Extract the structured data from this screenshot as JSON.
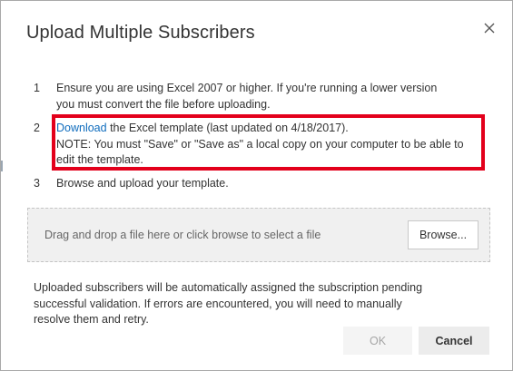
{
  "dialog": {
    "title": "Upload Multiple Subscribers",
    "close_icon": "close-icon"
  },
  "steps": [
    {
      "number": "1",
      "lines": [
        "Ensure you are using Excel 2007 or higher. If you're running a lower version",
        "you must convert the file before uploading."
      ]
    },
    {
      "number": "2",
      "link_text": "Download",
      "line1_rest": " the Excel template (last updated on 4/18/2017).",
      "lines": [
        "NOTE: You must \"Save\" or \"Save as\" a local copy on your computer to be able to",
        "edit the template."
      ]
    },
    {
      "number": "3",
      "lines": [
        "Browse and upload your template."
      ]
    }
  ],
  "dropzone": {
    "text": "Drag and drop a file here or click browse to select a file",
    "browse_label": "Browse..."
  },
  "note": {
    "lines": [
      "Uploaded subscribers will be automatically assigned the subscription pending",
      "successful validation. If errors are encountered, you will need to manually",
      "resolve them and retry."
    ]
  },
  "footer": {
    "ok_label": "OK",
    "cancel_label": "Cancel"
  },
  "colors": {
    "link": "#0f6cbd",
    "highlight_border": "#e3001b"
  }
}
